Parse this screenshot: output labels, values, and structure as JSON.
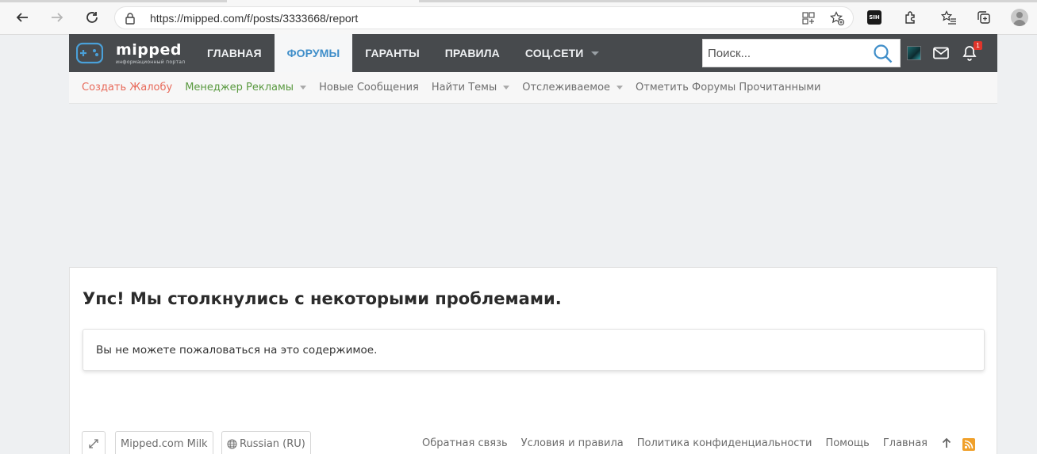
{
  "browser": {
    "url": "https://mipped.com/f/posts/3333668/report",
    "extension_label": "SIH"
  },
  "site": {
    "logo_text": "mipped",
    "logo_subtitle": "информационный портал",
    "nav": [
      {
        "label": "Главная",
        "active": false
      },
      {
        "label": "Форумы",
        "active": true
      },
      {
        "label": "Гаранты",
        "active": false
      },
      {
        "label": "Правила",
        "active": false
      },
      {
        "label": "Соц.Сети",
        "active": false,
        "has_dropdown": true
      }
    ],
    "search_placeholder": "Поиск...",
    "notification_count": "1",
    "colors": {
      "header_bg": "#474a4d",
      "active_tab_text": "#3f8ec9",
      "alert_badge": "#e0352b"
    }
  },
  "sub_nav": [
    {
      "label": "Создать Жалобу",
      "style": "red"
    },
    {
      "label": "Менеджер Рекламы",
      "style": "green",
      "dropdown": true
    },
    {
      "label": "Новые Сообщения"
    },
    {
      "label": "Найти Темы",
      "dropdown": true
    },
    {
      "label": "Отслеживаемое",
      "dropdown": true
    },
    {
      "label": "Отметить Форумы Прочитанными"
    }
  ],
  "main": {
    "title": "Упс! Мы столкнулись с некоторыми проблемами.",
    "error_message": "Вы не можете пожаловаться на это содержимое."
  },
  "footer": {
    "style_chooser": "Mipped.com Milk",
    "language": "Russian (RU)",
    "links": [
      "Обратная связь",
      "Условия и правила",
      "Политика конфиденциальности",
      "Помощь",
      "Главная"
    ]
  }
}
